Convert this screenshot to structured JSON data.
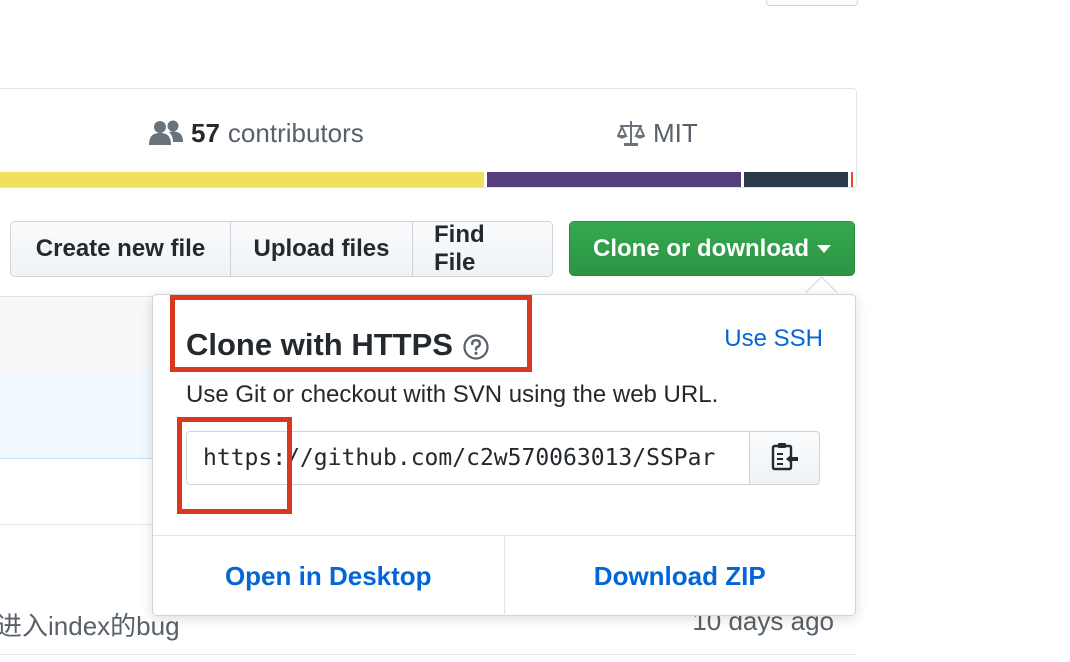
{
  "summary": {
    "contributors_count": "57",
    "contributors_label": "contributors",
    "license": "MIT",
    "icons": [
      "people-icon",
      "law-icon"
    ]
  },
  "language_bar": {
    "colors": [
      "#f1e05a",
      "#563d7c",
      "#2b3a4a",
      "#e34c26"
    ]
  },
  "file_nav": {
    "create_new_file": "Create new file",
    "upload_files": "Upload files",
    "find_file": "Find File"
  },
  "clone_button": {
    "label": "Clone or download",
    "color": "#2c9444"
  },
  "popover": {
    "title": "Clone with HTTPS",
    "use_ssh": "Use SSH",
    "description": "Use Git or checkout with SVN using the web URL.",
    "url": "https://github.com/c2w570063013/SSPar",
    "open_in_desktop": "Open in Desktop",
    "download_zip": "Download ZIP"
  },
  "commit_row": {
    "message": "进入index的bug",
    "age": "10 days ago"
  },
  "annotation": {
    "color": "#d9381e"
  }
}
